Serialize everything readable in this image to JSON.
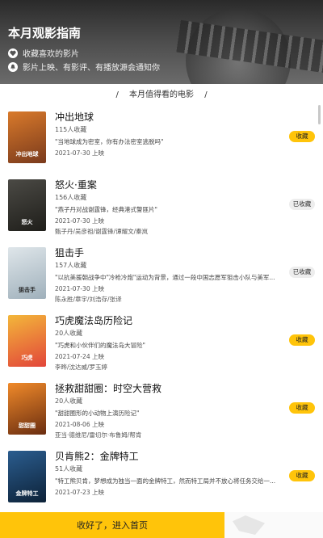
{
  "header": {
    "title": "本月观影指南",
    "features": [
      {
        "icon": "heart-icon",
        "text": "收藏喜欢的影片"
      },
      {
        "icon": "bell-icon",
        "text": "影片上映、有影评、有播放源会通知你"
      }
    ]
  },
  "section": {
    "title": "本月值得看的电影",
    "slash": "/"
  },
  "movies": [
    {
      "title": "冲出地球",
      "count": "115人收藏",
      "desc": "\"当地球成为密室，你有办法密室逃脱吗\"",
      "date": "2021-07-30 上映",
      "cast": "",
      "button": "收藏",
      "state": "collect",
      "poster_text": "冲出地球",
      "poster_colors": [
        "#d97a2b",
        "#7a3a1c"
      ]
    },
    {
      "title": "怒火·重案",
      "count": "156人收藏",
      "desc": "\"燕子丹对战谢霆锋，经典港式警匪片\"",
      "date": "2021-07-30 上映",
      "cast": "甄子丹/吴彦祖/谢霆锋/谭耀文/秦岚",
      "button": "已收藏",
      "state": "collected",
      "poster_text": "怒火",
      "poster_colors": [
        "#4b4a45",
        "#1f1e1a"
      ]
    },
    {
      "title": "狙击手",
      "count": "157人收藏",
      "desc": "\"以抗美援朝战争中\"冷枪冷炮\"运动为背景，通过一段中国志愿军狙击小队与美军...",
      "date": "2021-07-30 上映",
      "cast": "陈永胜/章宇/刘浩存/张译",
      "button": "已收藏",
      "state": "collected",
      "poster_text": "狙击手",
      "poster_colors": [
        "#dfe6ea",
        "#9fb0bb"
      ]
    },
    {
      "title": "巧虎魔法岛历险记",
      "count": "20人收藏",
      "desc": "\"巧虎和小伙伴们的魔法岛大冒险\"",
      "date": "2021-07-24 上映",
      "cast": "李晔/沈达威/罗玉婷",
      "button": "收藏",
      "state": "collect",
      "poster_text": "巧虎",
      "poster_colors": [
        "#f3b73a",
        "#e2453a"
      ]
    },
    {
      "title": "拯救甜甜圈：时空大营救",
      "count": "20人收藏",
      "desc": "\"甜甜圈形的小动物上演历险记\"",
      "date": "2021-08-06 上映",
      "cast": "亚当·德维尼/雷切尔·布鲁姆/帮肯",
      "button": "收藏",
      "state": "collect",
      "poster_text": "甜甜圈",
      "poster_colors": [
        "#f08a2a",
        "#6a2d10"
      ]
    },
    {
      "title": "贝肯熊2：金牌特工",
      "count": "51人收藏",
      "desc": "\"特工熊贝肯，梦想成为独当一面的金牌特工，然而特工局并不放心将任务交给一...",
      "date": "2021-07-23 上映",
      "cast": "",
      "button": "收藏",
      "state": "collect",
      "poster_text": "金牌特工",
      "poster_colors": [
        "#2b5d8f",
        "#0d2238"
      ]
    }
  ],
  "footer": {
    "button_label": "收好了，进入首页"
  },
  "colors": {
    "accent": "#ffc40a",
    "collected_bg": "#ededed"
  }
}
